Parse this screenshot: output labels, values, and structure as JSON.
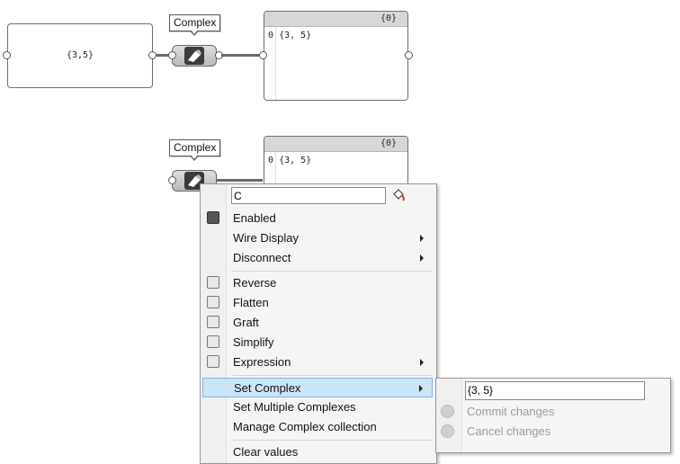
{
  "canvas": {
    "panel_text": "{3,5}",
    "component_tooltip_top": "Complex",
    "component_tooltip_bottom": "Complex",
    "data_top": {
      "path": "{0}",
      "index": "0",
      "value": "{3, 5}"
    },
    "data_bottom": {
      "path": "{0}",
      "index": "0",
      "value": "{3, 5}"
    }
  },
  "menu": {
    "name_value": "C",
    "items": [
      {
        "label": "Enabled",
        "icon": "enabled-icon",
        "submenu": false
      },
      {
        "label": "Wire Display",
        "icon": "",
        "submenu": true
      },
      {
        "label": "Disconnect",
        "icon": "",
        "submenu": true
      },
      {
        "label": "Reverse",
        "icon": "reverse-icon",
        "submenu": false
      },
      {
        "label": "Flatten",
        "icon": "flatten-icon",
        "submenu": false
      },
      {
        "label": "Graft",
        "icon": "graft-icon",
        "submenu": false
      },
      {
        "label": "Simplify",
        "icon": "simplify-icon",
        "submenu": false
      },
      {
        "label": "Expression",
        "icon": "expression-icon",
        "submenu": true
      },
      {
        "label": "Set Complex",
        "icon": "",
        "submenu": true
      },
      {
        "label": "Set Multiple Complexes",
        "icon": "",
        "submenu": false
      },
      {
        "label": "Manage Complex collection",
        "icon": "",
        "submenu": false
      },
      {
        "label": "Clear values",
        "icon": "",
        "submenu": false
      }
    ]
  },
  "submenu": {
    "value": "{3, 5}",
    "commit_label": "Commit changes",
    "cancel_label": "Cancel changes"
  },
  "colors": {
    "highlight": "#cce4f7",
    "highlight_border": "#7eb4ea",
    "wire": "#6a6a6a"
  }
}
